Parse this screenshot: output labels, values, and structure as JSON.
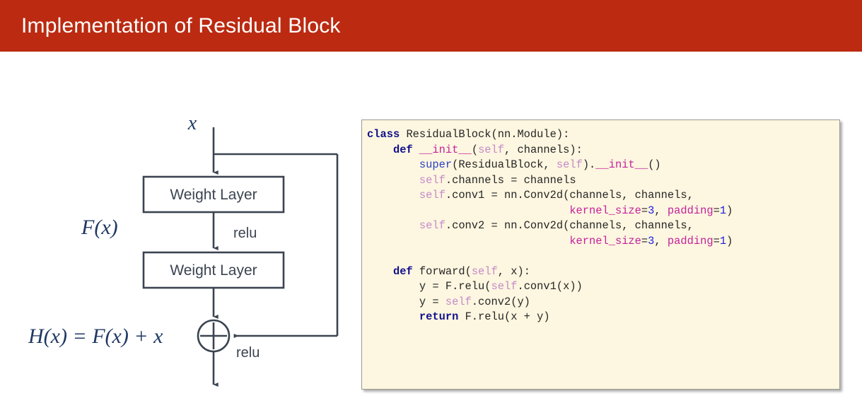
{
  "slide": {
    "title": "Implementation of Residual Block",
    "banner_color": "#BB2A11",
    "background_color": "#FFFFFF"
  },
  "diagram": {
    "name": "residual-block-diagram",
    "input_label": "x",
    "residual_branch_label": "F(x)",
    "output_label": "H(x) = F(x) + x",
    "blocks": [
      {
        "label": "Weight Layer"
      },
      {
        "label": "Weight Layer"
      }
    ],
    "activations": [
      {
        "label": "relu"
      },
      {
        "label": "relu"
      }
    ],
    "sum_node": {
      "symbol": "+",
      "shape": "circle-plus"
    },
    "stroke_color": "#3b4450",
    "math_color": "#1f3864"
  },
  "code_panel": {
    "name": "python-code-block",
    "language": "python",
    "background_color": "#FDF6E0",
    "border_color": "#9A9A93",
    "lines": [
      "class ResidualBlock(nn.Module):",
      "    def __init__(self, channels):",
      "        super(ResidualBlock, self).__init__()",
      "        self.channels = channels",
      "        self.conv1 = nn.Conv2d(channels, channels,",
      "                               kernel_size=3, padding=1)",
      "        self.conv2 = nn.Conv2d(channels, channels,",
      "                               kernel_size=3, padding=1)",
      "",
      "    def forward(self, x):",
      "        y = F.relu(self.conv1(x))",
      "        y = self.conv2(y)",
      "        return F.relu(x + y)"
    ],
    "syntax_colors": {
      "keyword": "#11118C",
      "builtin": "#2B41C4",
      "self": "#C58BC8",
      "dunder_or_kwarg": "#C4219B",
      "number": "#2020E0",
      "plain": "#262626"
    }
  }
}
